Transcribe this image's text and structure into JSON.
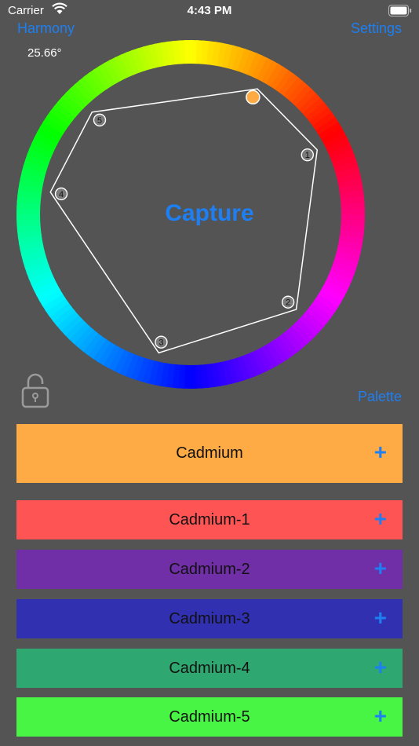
{
  "status": {
    "carrier": "Carrier",
    "time": "4:43 PM"
  },
  "nav": {
    "harmony": "Harmony",
    "settings": "Settings",
    "palette": "Palette"
  },
  "angle": "25.66°",
  "capture": "Capture",
  "wheel": {
    "markers": [
      {
        "label": "1",
        "hue_deg": 357
      },
      {
        "label": "2",
        "hue_deg": 288
      },
      {
        "label": "3",
        "hue_deg": 227
      },
      {
        "label": "4",
        "hue_deg": 141
      },
      {
        "label": "5",
        "hue_deg": 104
      }
    ],
    "base_marker": {
      "color": "#ffab45",
      "hue_deg": 32
    }
  },
  "main_swatch": {
    "name": "Cadmium",
    "color": "#ffab45",
    "action": "+"
  },
  "swatches": [
    {
      "name": "Cadmium-1",
      "color": "#ff5454",
      "action": "+"
    },
    {
      "name": "Cadmium-2",
      "color": "#702ea7",
      "action": "+"
    },
    {
      "name": "Cadmium-3",
      "color": "#3030b1",
      "action": "+"
    },
    {
      "name": "Cadmium-4",
      "color": "#2ea870",
      "action": "+"
    },
    {
      "name": "Cadmium-5",
      "color": "#48f545",
      "action": "+"
    }
  ]
}
